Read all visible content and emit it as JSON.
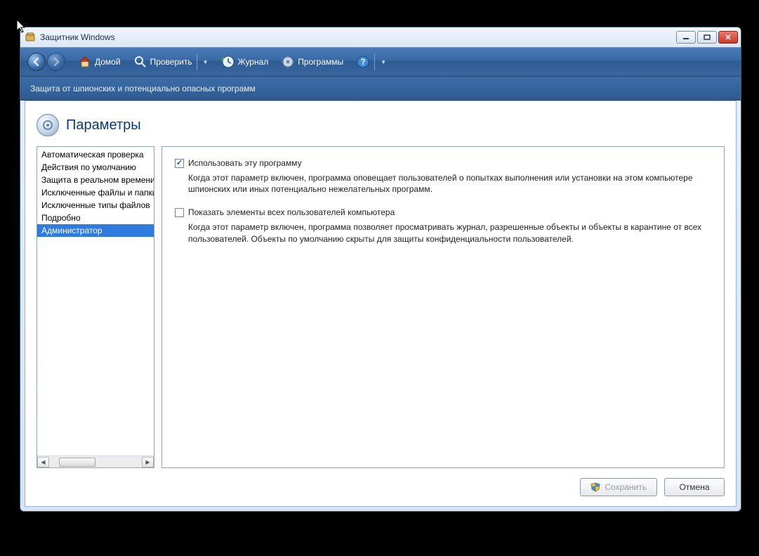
{
  "window": {
    "title": "Защитник Windows"
  },
  "toolbar": {
    "home": "Домой",
    "check": "Проверить",
    "history": "Журнал",
    "programs": "Программы"
  },
  "subheader": "Защита от шпионских и потенциально опасных программ",
  "page": {
    "heading": "Параметры"
  },
  "sidebar": {
    "items": [
      "Автоматическая проверка",
      "Действия по умолчанию",
      "Защита в реальном времени",
      "Исключенные файлы и папки",
      "Исключенные типы файлов",
      "Подробно",
      "Администратор"
    ],
    "selected_index": 6
  },
  "options": {
    "use_program": {
      "label": "Использовать эту программу",
      "checked": true,
      "desc": "Когда этот параметр включен, программа оповещает пользователей о попытках выполнения или установки на этом компьютере шпионских или иных потенциально нежелательных программ."
    },
    "show_all_users": {
      "label": "Показать элементы всех пользователей компьютера",
      "checked": false,
      "desc": "Когда этот параметр включен, программа позволяет просматривать журнал, разрешенные объекты и объекты в карантине от всех пользователей. Объекты по умолчанию скрыты для защиты конфиденциальности пользователей."
    }
  },
  "buttons": {
    "save": "Сохранить",
    "cancel": "Отмена"
  }
}
